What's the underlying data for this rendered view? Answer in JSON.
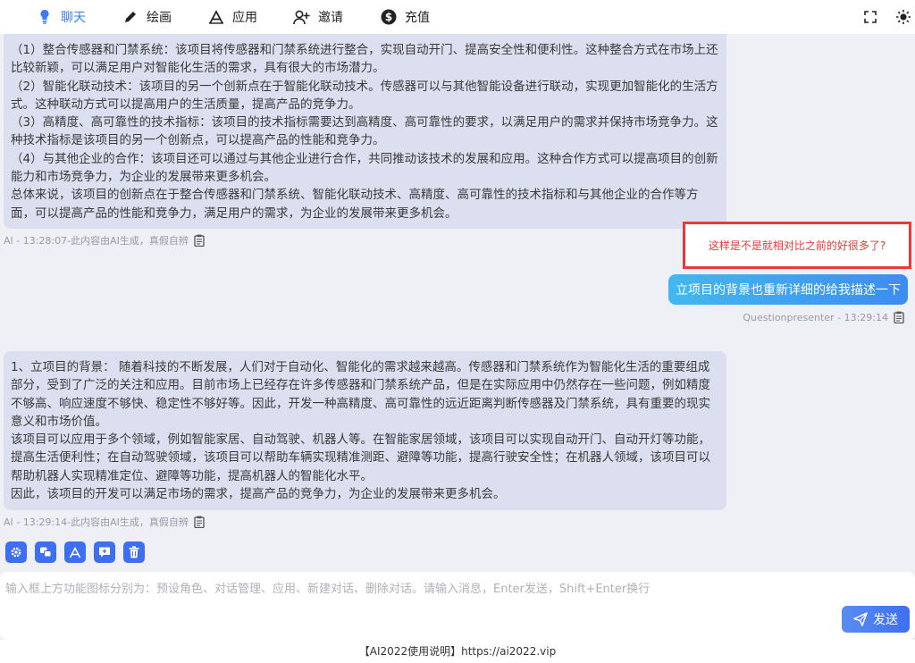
{
  "nav": {
    "items": [
      {
        "label": "聊天",
        "icon": "lightbulb-icon",
        "active": true
      },
      {
        "label": "绘画",
        "icon": "pen-icon"
      },
      {
        "label": "应用",
        "icon": "app-icon"
      },
      {
        "label": "邀请",
        "icon": "user-add-icon"
      },
      {
        "label": "充值",
        "icon": "dollar-icon"
      }
    ],
    "right": [
      "fullscreen-icon",
      "sun-icon"
    ],
    "accent": "#3a7df0"
  },
  "messages": {
    "ai1": {
      "lines": [
        "（1）整合传感器和门禁系统：该项目将传感器和门禁系统进行整合，实现自动开门、提高安全性和便利性。这种整合方式在市场上还比较新颖，可以满足用户对智能化生活的需求，具有很大的市场潜力。",
        "（2）智能化联动技术：该项目的另一个创新点在于智能化联动技术。传感器可以与其他智能设备进行联动，实现更加智能化的生活方式。这种联动方式可以提高用户的生活质量，提高产品的竞争力。",
        "（3）高精度、高可靠性的技术指标：该项目的技术指标需要达到高精度、高可靠性的要求，以满足用户的需求并保持市场竞争力。这种技术指标是该项目的另一个创新点，可以提高产品的性能和竞争力。",
        "（4）与其他企业的合作：该项目还可以通过与其他企业进行合作，共同推动该技术的发展和应用。这种合作方式可以提高项目的创新能力和市场竞争力，为企业的发展带来更多机会。",
        "总体来说，该项目的创新点在于整合传感器和门禁系统、智能化联动技术、高精度、高可靠性的技术指标和与其他企业的合作等方面，可以提高产品的性能和竞争力，满足用户的需求，为企业的发展带来更多机会。"
      ],
      "meta": "AI - 13:28:07-此内容由AI生成，真假自辨"
    },
    "annotation": "这样是不是就相对比之前的好很多了?",
    "user1": {
      "text": "立项目的背景也重新详细的给我描述一下",
      "meta": "Questionpresenter - 13:29:14"
    },
    "ai2": {
      "lines": [
        "1、立项目的背景： 随着科技的不断发展，人们对于自动化、智能化的需求越来越高。传感器和门禁系统作为智能化生活的重要组成部分，受到了广泛的关注和应用。目前市场上已经存在许多传感器和门禁系统产品，但是在实际应用中仍然存在一些问题，例如精度不够高、响应速度不够快、稳定性不够好等。因此，开发一种高精度、高可靠性的远近距离判断传感器及门禁系统，具有重要的现实意义和市场价值。",
        "该项目可以应用于多个领域，例如智能家居、自动驾驶、机器人等。在智能家居领域，该项目可以实现自动开门、自动开灯等功能，提高生活便利性；在自动驾驶领域，该项目可以帮助车辆实现精准测距、避障等功能，提高行驶安全性；在机器人领域，该项目可以帮助机器人实现精准定位、避障等功能，提高机器人的智能化水平。",
        "因此，该项目的开发可以满足市场的需求，提高产品的竞争力，为企业的发展带来更多机会。"
      ],
      "meta": "AI - 13:29:14-此内容由AI生成，真假自辨"
    }
  },
  "tools": [
    "gear-icon",
    "chat-manage-icon",
    "app-icon",
    "new-chat-icon",
    "trash-icon"
  ],
  "input": {
    "placeholder": "输入框上方功能图标分别为：预设角色、对话管理、应用、新建对话、删除对话。请输入消息，Enter发送，Shift+Enter换行",
    "value": "",
    "send_label": "发送"
  },
  "footer": "【AI2022使用说明】https://ai2022.vip"
}
